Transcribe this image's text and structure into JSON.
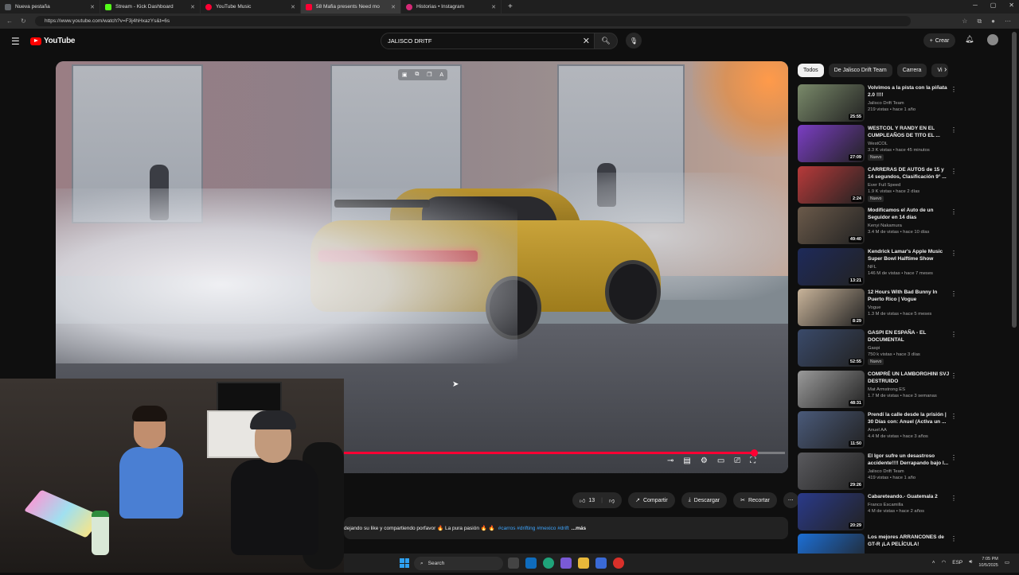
{
  "browser": {
    "tabs": [
      {
        "label": "Nueva pestaña",
        "color": "#5f6368"
      },
      {
        "label": "Stream - Kick Dashboard",
        "color": "#53fc18"
      },
      {
        "label": "YouTube Music",
        "color": "#ff0033"
      },
      {
        "label": "58 Mafia presents Need mo",
        "color": "#ff0033"
      },
      {
        "label": "Historias • Instagram",
        "color": "#d62976"
      }
    ],
    "url": "https://www.youtube.com/watch?v=F3j4hHxazYs&t=6s"
  },
  "youtube": {
    "logo_text": "YouTube",
    "search_value": "JALISCO DRITF",
    "create_label": "Crear"
  },
  "player": {
    "progress_fraction": 0.93
  },
  "actions": {
    "likes": "13",
    "share": "Compartir",
    "download": "Descargar",
    "clip": "Recortar"
  },
  "description": {
    "text": "dejando su like y compartiendo porfavor 🔥 La pura pasión 🔥 🔥",
    "tags": "#carros #drifting #mexico #drift",
    "more": "...más"
  },
  "chips": [
    "Todos",
    "De Jalisco Drift Team",
    "Carrera",
    "Vi"
  ],
  "recommendations": [
    {
      "title": "Volvimos a la pista con la piñata 2.0 !!!!",
      "channel": "Jalisco Drift Team",
      "meta": "219 vistas • hace 1 año",
      "duration": "25:55",
      "new": "",
      "thumb": "#7a8a6a"
    },
    {
      "title": "WESTCOL Y RANDY EN EL CUMPLEAÑOS DE TITO EL ...",
      "channel": "WestCOL",
      "meta": "3.3 K vistas • hace 45 minutos",
      "duration": "27:09",
      "new": "Nuevo",
      "thumb": "#7b3ec4"
    },
    {
      "title": "CARRERAS DE AUTOS de 15 y 14 segundos, Clasificación 9° ...",
      "channel": "Ever Full Speed",
      "meta": "1.9 K vistas • hace 2 días",
      "duration": "2:24",
      "new": "Nuevo",
      "thumb": "#b83a3a"
    },
    {
      "title": "Modificamos el Auto de un Seguidor en 14 días",
      "channel": "Kenyi Nakamura",
      "meta": "3.4 M de vistas • hace 10 días",
      "duration": "49:40",
      "new": "",
      "thumb": "#6b5a4a"
    },
    {
      "title": "Kendrick Lamar's Apple Music Super Bowl Halftime Show",
      "channel": "NFL",
      "meta": "146 M de vistas • hace 7 meses",
      "duration": "13:21",
      "new": "",
      "thumb": "#1e2a5a"
    },
    {
      "title": "12 Hours With Bad Bunny In Puerto Rico | Vogue",
      "channel": "Vogue",
      "meta": "1.3 M de vistas • hace 5 meses",
      "duration": "8:29",
      "new": "",
      "thumb": "#c9b49a"
    },
    {
      "title": "GASPI EN ESPAÑA - EL DOCUMENTAL",
      "channel": "Gaspi",
      "meta": "750 k vistas • hace 3 días",
      "duration": "52:55",
      "new": "Nuevo",
      "thumb": "#3a4a6a"
    },
    {
      "title": "COMPRÉ UN LAMBORGHINI SVJ DESTRUIDO",
      "channel": "Mat Armstrong ES",
      "meta": "1.7 M de vistas • hace 3 semanas",
      "duration": "48:31",
      "new": "",
      "thumb": "#9a9a9a"
    },
    {
      "title": "Prendí la calle desde la prisión | 30 Días con: Anuel (Activa un ...",
      "channel": "Anuel AA",
      "meta": "4.4 M de vistas • hace 3 años",
      "duration": "11:50",
      "new": "",
      "thumb": "#4a5a7a"
    },
    {
      "title": "El Igor sufre un desastroso accidente!!!! Derrapando bajo l...",
      "channel": "Jalisco Drift Team",
      "meta": "419 vistas • hace 1 año",
      "duration": "29:26",
      "new": "",
      "thumb": "#5a5a5e"
    },
    {
      "title": "Cabareteando.- Guatemala 2",
      "channel": "Franco Escamilla",
      "meta": "4 M de vistas • hace 2 años",
      "duration": "20:29",
      "new": "",
      "thumb": "#2a3a8a"
    },
    {
      "title": "Los mejores ARRANCONES de GT-R ¡LA PELÍCULA!",
      "channel": "",
      "meta": "",
      "duration": "",
      "new": "",
      "thumb": "#1c6fd6"
    }
  ],
  "taskbar": {
    "search_label": "Search",
    "lang": "ESP",
    "time": "7:05 PM",
    "date": "10/5/2025"
  }
}
